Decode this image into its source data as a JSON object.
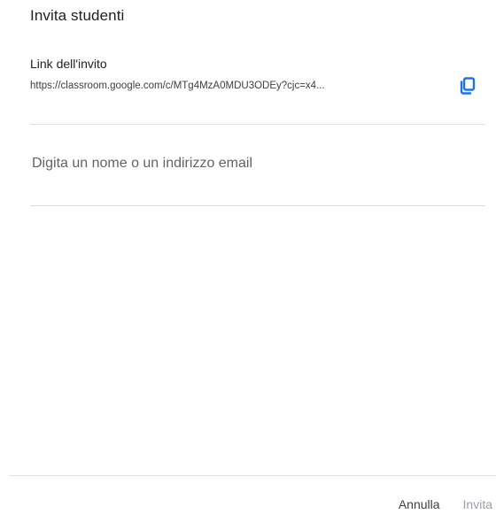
{
  "dialog": {
    "title": "Invita studenti"
  },
  "invite_link": {
    "label": "Link dell'invito",
    "url": "https://classroom.google.com/c/MTg4MzA0MDU3ODEy?cjc=x4..."
  },
  "invite_input": {
    "placeholder": "Digita un nome o un indirizzo email",
    "value": ""
  },
  "actions": {
    "cancel_label": "Annulla",
    "invite_label": "Invita"
  },
  "colors": {
    "accent": "#1a73e8",
    "disabled_text": "#9aa0a6"
  },
  "icons": {
    "copy": "copy-icon"
  }
}
